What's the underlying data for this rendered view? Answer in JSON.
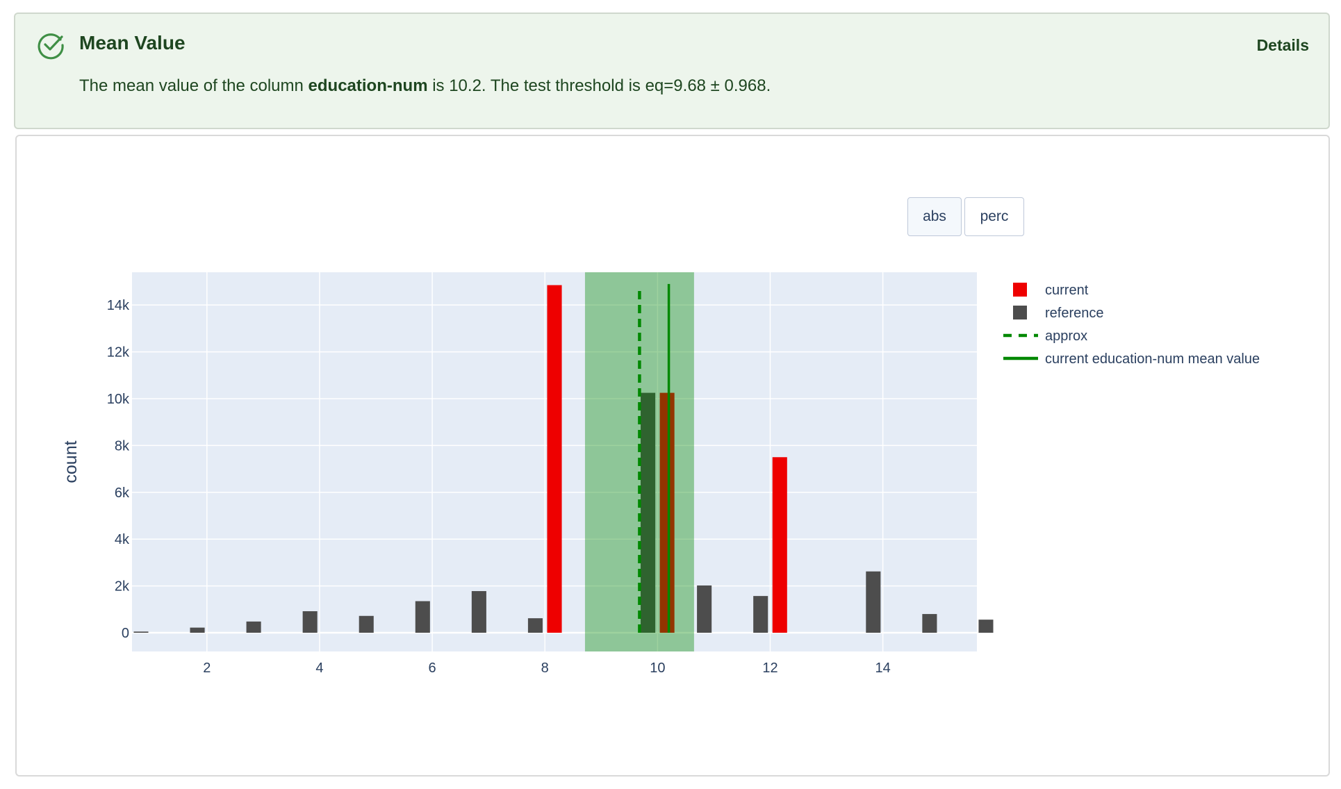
{
  "test": {
    "title": "Mean Value",
    "details_label": "Details",
    "status_icon": "check-circle-icon",
    "description_prefix": "The mean value of the column ",
    "column_name": "education-num",
    "description_suffix": " is 10.2. The test threshold is eq=9.68 ± 0.968.",
    "status_color": "#3f8f45"
  },
  "toggles": {
    "abs_label": "abs",
    "perc_label": "perc",
    "selected": "abs"
  },
  "chart_data": {
    "type": "bar",
    "ylabel": "count",
    "xlabel": "",
    "xlim": [
      0.67,
      15.67
    ],
    "ylim": [
      -800,
      15400
    ],
    "x_ticks": [
      2,
      4,
      6,
      8,
      10,
      12,
      14
    ],
    "x_tick_labels": [
      "2",
      "4",
      "6",
      "8",
      "10",
      "12",
      "14"
    ],
    "y_ticks": [
      0,
      2000,
      4000,
      6000,
      8000,
      10000,
      12000,
      14000
    ],
    "y_tick_labels": [
      "0",
      "2k",
      "4k",
      "6k",
      "8k",
      "10k",
      "12k",
      "14k"
    ],
    "grid": true,
    "legend_position": "top-right",
    "colors": {
      "current": "#ee0000",
      "reference": "#4d4d4d",
      "approx": "#008800",
      "mean": "#008800",
      "band": "#8fbc8f",
      "plot_bg": "#e5ecf6"
    },
    "series": [
      {
        "name": "current",
        "x": [
          1,
          2,
          3,
          4,
          5,
          6,
          7,
          8,
          9,
          10,
          11,
          12,
          13,
          14,
          15,
          16
        ],
        "values": [
          0,
          0,
          0,
          0,
          0,
          0,
          0,
          14850,
          0,
          10250,
          0,
          7500,
          0,
          0,
          0,
          0
        ]
      },
      {
        "name": "reference",
        "x": [
          1,
          2,
          3,
          4,
          5,
          6,
          7,
          8,
          9,
          10,
          11,
          12,
          13,
          14,
          15,
          16
        ],
        "values": [
          50,
          220,
          480,
          920,
          720,
          1350,
          1780,
          620,
          0,
          10250,
          2020,
          1570,
          0,
          2620,
          800,
          560
        ]
      }
    ],
    "approx": {
      "name": "approx",
      "x": 9.68,
      "y_range": [
        0,
        14700
      ]
    },
    "mean_line": {
      "name": "current education-num mean value",
      "x": 10.2,
      "y_range": [
        0,
        14900
      ]
    },
    "threshold_band": {
      "x_range": [
        8.712,
        10.648
      ]
    }
  }
}
